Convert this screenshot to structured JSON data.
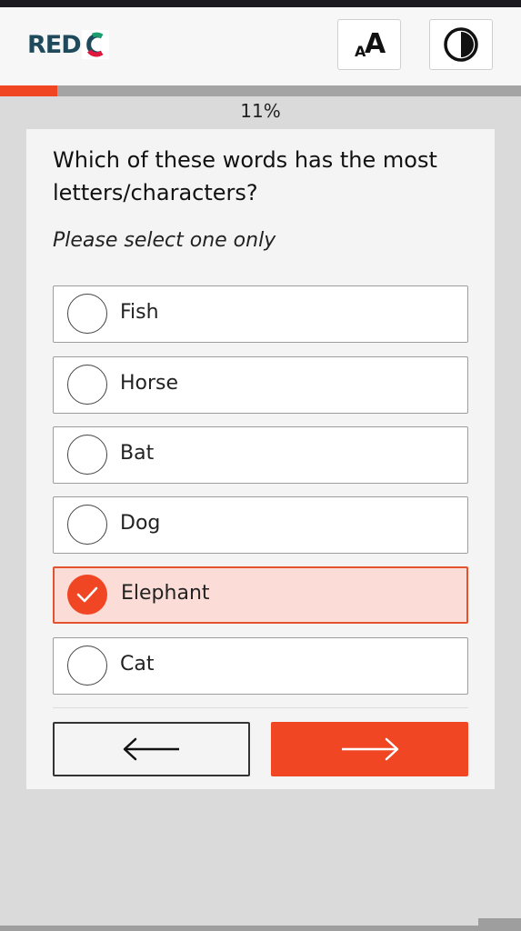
{
  "header": {
    "logo_text": "RED",
    "logo_full": "REDC",
    "font_button_icon": "font-size-icon",
    "contrast_button_icon": "contrast-icon"
  },
  "progress": {
    "value": 0.11,
    "label": "11%",
    "fill_color": "#f14624"
  },
  "question": {
    "text": "Which of these words has the most letters/characters?",
    "instruction": "Please select one only"
  },
  "options": [
    {
      "label": "Fish",
      "selected": false
    },
    {
      "label": "Horse",
      "selected": false
    },
    {
      "label": "Bat",
      "selected": false
    },
    {
      "label": "Dog",
      "selected": false
    },
    {
      "label": "Elephant",
      "selected": true
    },
    {
      "label": "Cat",
      "selected": false
    }
  ],
  "navigation": {
    "back_icon": "arrow-left-icon",
    "next_icon": "arrow-right-icon"
  },
  "colors": {
    "accent": "#f14624",
    "selected_bg": "#fcdcd7",
    "logo_blue": "#1f4a5c"
  }
}
